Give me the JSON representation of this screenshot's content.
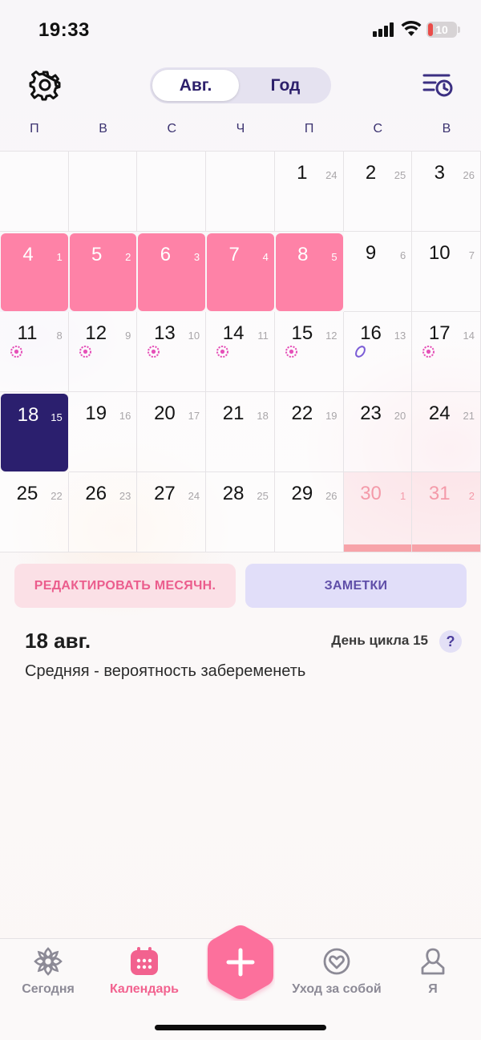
{
  "status_bar": {
    "time": "19:33",
    "battery": "10"
  },
  "header": {
    "segment": {
      "active": "Авг.",
      "inactive": "Год"
    }
  },
  "weekdays": [
    "П",
    "В",
    "С",
    "Ч",
    "П",
    "С",
    "В"
  ],
  "calendar": {
    "weeks": [
      [
        null,
        null,
        null,
        null,
        {
          "day": "1",
          "cycle": "24"
        },
        {
          "day": "2",
          "cycle": "25"
        },
        {
          "day": "3",
          "cycle": "26"
        }
      ],
      [
        {
          "day": "4",
          "cycle": "1",
          "state": "period"
        },
        {
          "day": "5",
          "cycle": "2",
          "state": "period"
        },
        {
          "day": "6",
          "cycle": "3",
          "state": "period"
        },
        {
          "day": "7",
          "cycle": "4",
          "state": "period"
        },
        {
          "day": "8",
          "cycle": "5",
          "state": "period"
        },
        {
          "day": "9",
          "cycle": "6"
        },
        {
          "day": "10",
          "cycle": "7"
        }
      ],
      [
        {
          "day": "11",
          "cycle": "8",
          "mark": "fertile"
        },
        {
          "day": "12",
          "cycle": "9",
          "mark": "fertile"
        },
        {
          "day": "13",
          "cycle": "10",
          "mark": "fertile"
        },
        {
          "day": "14",
          "cycle": "11",
          "mark": "fertile"
        },
        {
          "day": "15",
          "cycle": "12",
          "mark": "fertile"
        },
        {
          "day": "16",
          "cycle": "13",
          "mark": "ovulation"
        },
        {
          "day": "17",
          "cycle": "14",
          "mark": "fertile"
        }
      ],
      [
        {
          "day": "18",
          "cycle": "15",
          "state": "today"
        },
        {
          "day": "19",
          "cycle": "16"
        },
        {
          "day": "20",
          "cycle": "17"
        },
        {
          "day": "21",
          "cycle": "18"
        },
        {
          "day": "22",
          "cycle": "19"
        },
        {
          "day": "23",
          "cycle": "20"
        },
        {
          "day": "24",
          "cycle": "21"
        }
      ],
      [
        {
          "day": "25",
          "cycle": "22"
        },
        {
          "day": "26",
          "cycle": "23"
        },
        {
          "day": "27",
          "cycle": "24"
        },
        {
          "day": "28",
          "cycle": "25"
        },
        {
          "day": "29",
          "cycle": "26"
        },
        {
          "day": "30",
          "cycle": "1",
          "state": "predicted"
        },
        {
          "day": "31",
          "cycle": "2",
          "state": "predicted"
        }
      ]
    ]
  },
  "actions": {
    "edit_period": "РЕДАКТИРОВАТЬ МЕСЯЧН.",
    "notes": "ЗАМЕТКИ"
  },
  "details": {
    "date": "18 авг.",
    "cycle_day": "День цикла 15",
    "help": "?",
    "fertility": "Средняя - вероятность забеременеть"
  },
  "tabbar": {
    "items": [
      {
        "label": "Сегодня",
        "icon": "flower-icon"
      },
      {
        "label": "Календарь",
        "icon": "calendar-icon",
        "active": true
      },
      {
        "label": "Уход за собой",
        "icon": "self-care-icon"
      },
      {
        "label": "Я",
        "icon": "profile-icon"
      }
    ],
    "fab_icon": "plus-icon"
  },
  "colors": {
    "period": "#fe82a7",
    "today": "#2b1f6e",
    "accent": "#f2628f",
    "primary": "#2c1f6b"
  }
}
